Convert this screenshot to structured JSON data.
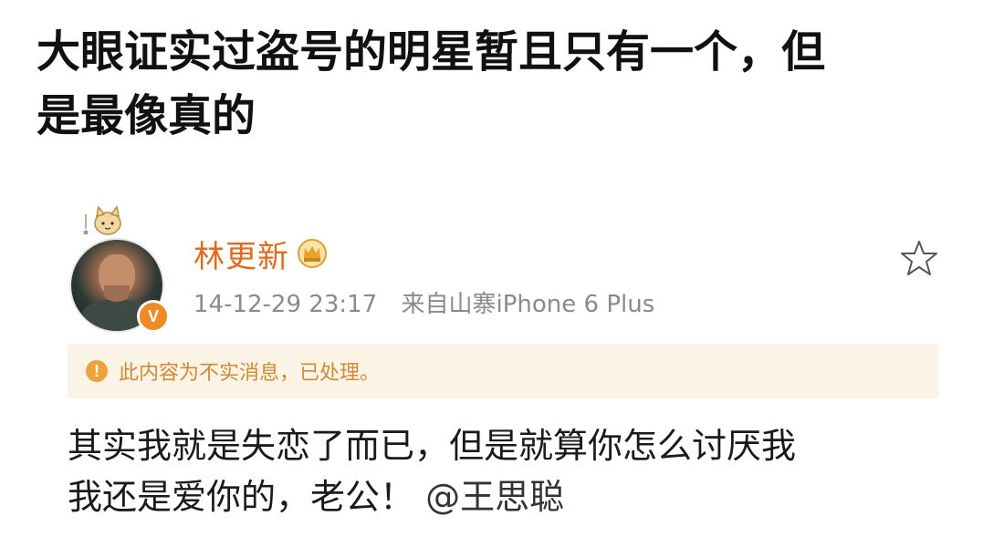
{
  "caption": {
    "line1": "大眼证实过盗号的明星暂且只有一个，但",
    "line2": "是最像真的"
  },
  "post": {
    "username": "林更新",
    "timestamp": "14-12-29 23:17",
    "source": "来自山寨iPhone 6 Plus",
    "verified_badge": "V",
    "notice_icon": "!",
    "notice_text": "此内容为不实消息，已处理。",
    "body_line1": "其实我就是失恋了而已，但是就算你怎么讨厌我",
    "body_line2_text": "我还是爱你的，老公！",
    "mention": "@王思聪",
    "icons": [
      "pendant-cat-icon",
      "crown-vip-icon",
      "favorite-star-icon",
      "warning-icon"
    ],
    "colors": {
      "username": "#e06a1e",
      "notice_bg": "#fbf3e6",
      "notice_text": "#d08a35",
      "verified": "#f08a24"
    }
  }
}
